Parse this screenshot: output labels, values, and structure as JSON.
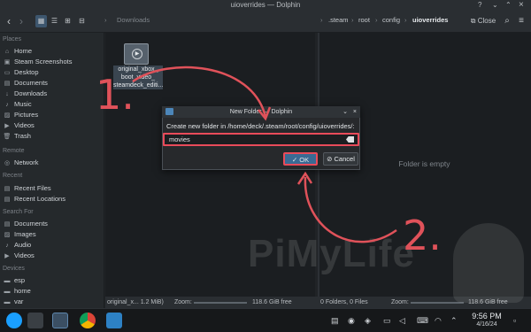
{
  "window": {
    "title": "uioverrides — Dolphin",
    "controls": {
      "help": "?",
      "minimize": "⌄",
      "maximize": "⌃",
      "close": "×"
    }
  },
  "toolbar": {
    "back": "‹",
    "forward": "›",
    "view_icons": "▦",
    "view_compact": "☰",
    "view_split": "⊞",
    "view_details": "⊟",
    "location_label": "Downloads",
    "breadcrumbs": [
      ".steam",
      "root",
      "config",
      "uioverrides"
    ],
    "close_label": "Close",
    "search": "⌕",
    "menu": "≡"
  },
  "sidebar": {
    "sections": {
      "places": "Places",
      "remote": "Remote",
      "recent": "Recent",
      "search_for": "Search For",
      "devices": "Devices"
    },
    "places": [
      {
        "icon": "⌂",
        "label": "Home"
      },
      {
        "icon": "▣",
        "label": "Steam Screenshots"
      },
      {
        "icon": "▭",
        "label": "Desktop"
      },
      {
        "icon": "▤",
        "label": "Documents"
      },
      {
        "icon": "↓",
        "label": "Downloads"
      },
      {
        "icon": "♪",
        "label": "Music"
      },
      {
        "icon": "▨",
        "label": "Pictures"
      },
      {
        "icon": "▶",
        "label": "Videos"
      },
      {
        "icon": "🗑",
        "label": "Trash"
      }
    ],
    "remote": [
      {
        "icon": "◎",
        "label": "Network"
      }
    ],
    "recent": [
      {
        "icon": "▤",
        "label": "Recent Files"
      },
      {
        "icon": "▤",
        "label": "Recent Locations"
      }
    ],
    "search_for": [
      {
        "icon": "▤",
        "label": "Documents"
      },
      {
        "icon": "▨",
        "label": "Images"
      },
      {
        "icon": "♪",
        "label": "Audio"
      },
      {
        "icon": "▶",
        "label": "Videos"
      }
    ],
    "devices": [
      {
        "icon": "▬",
        "label": "esp"
      },
      {
        "icon": "▬",
        "label": "home"
      },
      {
        "icon": "▬",
        "label": "var"
      }
    ]
  },
  "left_pane": {
    "file": {
      "name_lines": [
        "original_xbox_",
        "boot_video_",
        "steamdeck_editi..."
      ]
    },
    "status": {
      "selection": "original_x... 1.2 MiB)",
      "zoom_label": "Zoom:",
      "free": "118.6 GiB free"
    }
  },
  "right_pane": {
    "empty_text": "Folder is empty",
    "status": {
      "counts": "0 Folders, 0 Files",
      "zoom_label": "Zoom:",
      "free": "118.6 GiB free"
    }
  },
  "dialog": {
    "title": "New Folder — Dolphin",
    "prompt": "Create new folder in /home/deck/.steam/root/config/uioverrides/:",
    "input_value": "movies",
    "ok_label": "OK",
    "ok_icon": "✓",
    "cancel_label": "Cancel",
    "cancel_icon": "⊘",
    "collapse": "⌄",
    "close": "×"
  },
  "annotations": {
    "step1": "1.",
    "step2": "2.",
    "color": "#e0525a"
  },
  "watermark": {
    "text": "PiMyLife"
  },
  "taskbar": {
    "time": "9:56 PM",
    "date": "4/16/24"
  },
  "colors": {
    "accent": "#3d566e",
    "highlight": "#e94b5a",
    "background": "#1b1e21"
  }
}
